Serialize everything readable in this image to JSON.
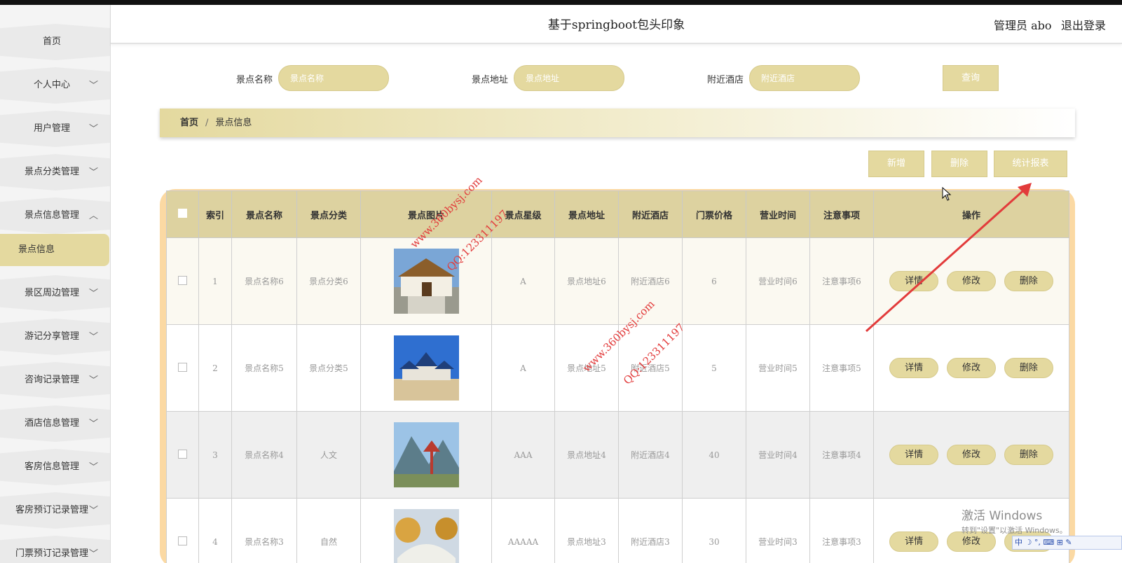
{
  "header": {
    "title": "基于springboot包头印象",
    "user": "管理员 abo",
    "logout": "退出登录"
  },
  "sidebar": {
    "items": [
      {
        "label": "首页",
        "chevron": ""
      },
      {
        "label": "个人中心",
        "chevron": "﹀"
      },
      {
        "label": "用户管理",
        "chevron": "﹀"
      },
      {
        "label": "景点分类管理",
        "chevron": "﹀"
      },
      {
        "label": "景点信息管理",
        "chevron": "︿"
      },
      {
        "label": "景区周边管理",
        "chevron": "﹀"
      },
      {
        "label": "游记分享管理",
        "chevron": "﹀"
      },
      {
        "label": "咨询记录管理",
        "chevron": "﹀"
      },
      {
        "label": "酒店信息管理",
        "chevron": "﹀"
      },
      {
        "label": "客房信息管理",
        "chevron": "﹀"
      },
      {
        "label": "客房预订记录管理",
        "chevron": "﹀"
      },
      {
        "label": "门票预订记录管理",
        "chevron": "﹀"
      }
    ],
    "active_sub": "景点信息"
  },
  "search": {
    "name_label": "景点名称",
    "name_placeholder": "景点名称",
    "address_label": "景点地址",
    "address_placeholder": "景点地址",
    "hotel_label": "附近酒店",
    "hotel_placeholder": "附近酒店",
    "query_button": "查询"
  },
  "breadcrumb": {
    "home": "首页",
    "separator": "/",
    "current": "景点信息"
  },
  "actions": {
    "add": "新增",
    "delete": "删除",
    "stats": "统计报表"
  },
  "table": {
    "headers": [
      "索引",
      "景点名称",
      "景点分类",
      "景点图片",
      "景点星级",
      "景点地址",
      "附近酒店",
      "门票价格",
      "营业时间",
      "注意事项",
      "操作"
    ],
    "op_labels": {
      "detail": "详情",
      "edit": "修改",
      "delete": "删除"
    },
    "rows": [
      {
        "index": "1",
        "name": "景点名称6",
        "category": "景点分类6",
        "image": "temple-photo",
        "stars": "A",
        "address": "景点地址6",
        "hotel": "附近酒店6",
        "price": "6",
        "hours": "营业时间6",
        "notes": "注意事项6"
      },
      {
        "index": "2",
        "name": "景点名称5",
        "category": "景点分类5",
        "image": "pavilion-photo",
        "stars": "A",
        "address": "景点地址5",
        "hotel": "附近酒店5",
        "price": "5",
        "hours": "营业时间5",
        "notes": "注意事项5"
      },
      {
        "index": "3",
        "name": "景点名称4",
        "category": "人文",
        "image": "mountain-pagoda-photo",
        "stars": "AAA",
        "address": "景点地址4",
        "hotel": "附近酒店4",
        "price": "40",
        "hours": "营业时间4",
        "notes": "注意事项4"
      },
      {
        "index": "4",
        "name": "景点名称3",
        "category": "自然",
        "image": "bridge-photo",
        "stars": "AAAAA",
        "address": "景点地址3",
        "hotel": "附近酒店3",
        "price": "30",
        "hours": "营业时间3",
        "notes": "注意事项3"
      }
    ]
  },
  "watermarks": [
    {
      "site": "www.360bysj.com",
      "qq": "QQ:123311197"
    },
    {
      "site": "www.360bysj.com",
      "qq": "QQ:123311197"
    }
  ],
  "windows_activation": {
    "title": "激活 Windows",
    "subtitle": "转到\"设置\"以激活 Windows。"
  },
  "ime_bar": "中 ☽ °, ⌨ ⊞ ✎",
  "colors": {
    "accent": "#e4d99f",
    "table_frame": "#fbd9a3",
    "annotation_arrow": "#e23b3b"
  }
}
